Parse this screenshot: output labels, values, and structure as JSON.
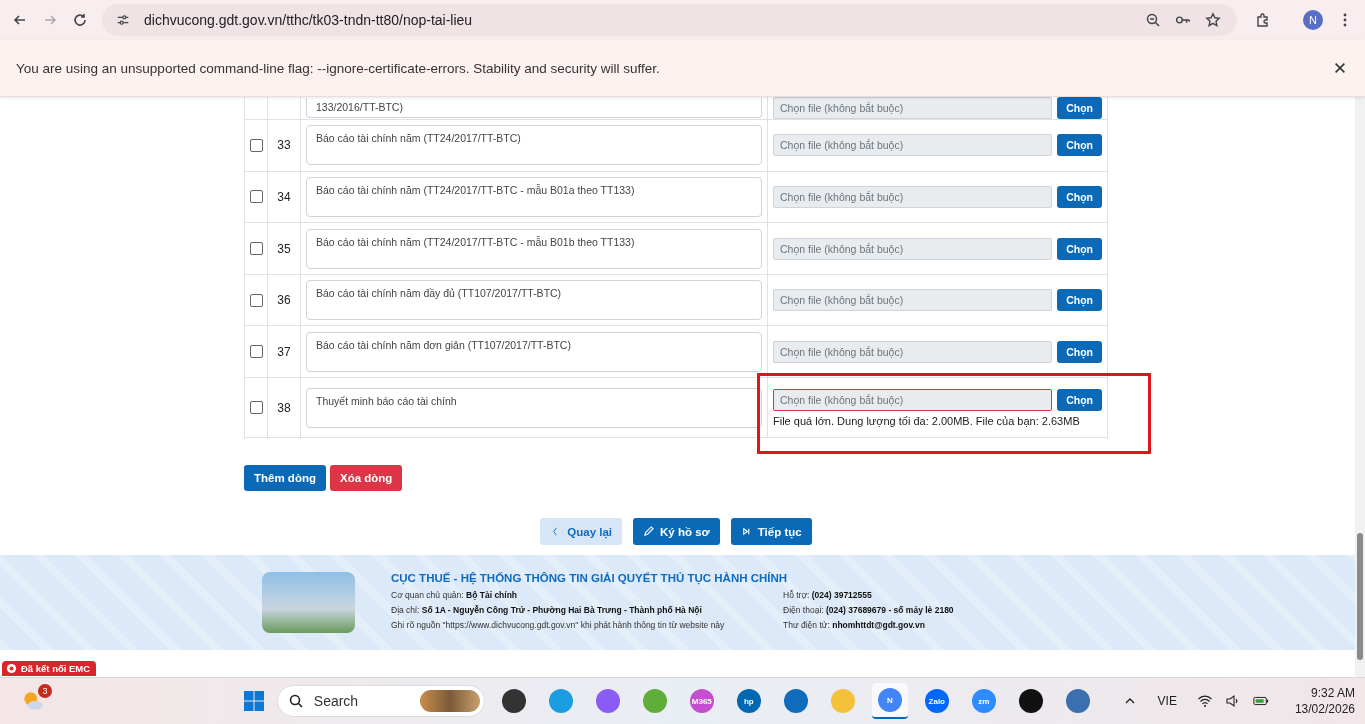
{
  "browser": {
    "url": "dichvucong.gdt.gov.vn/tthc/tk03-tndn-tt80/nop-tai-lieu",
    "profile_initial": "N"
  },
  "infobar": {
    "message": "You are using an unsupported command-line flag: --ignore-certificate-errors. Stability and security will suffer."
  },
  "table": {
    "rows": [
      {
        "description": "133/2016/TT-BTC)",
        "placeholder": "Chọn file (không bắt buộc)",
        "button": "Chọn",
        "cut": true,
        "error": false,
        "highlighted": false
      },
      {
        "number": "33",
        "checked": false,
        "description": "Báo cáo tài chính năm (TT24/2017/TT-BTC)",
        "placeholder": "Chọn file (không bắt buộc)",
        "button": "Chọn",
        "cut": false,
        "error": false,
        "highlighted": false
      },
      {
        "number": "34",
        "checked": false,
        "description": "Báo cáo tài chính năm (TT24/2017/TT-BTC - mẫu B01a theo TT133)",
        "placeholder": "Chọn file (không bắt buộc)",
        "button": "Chọn",
        "cut": false,
        "error": false,
        "highlighted": false
      },
      {
        "number": "35",
        "checked": false,
        "description": "Báo cáo tài chính năm (TT24/2017/TT-BTC - mẫu B01b theo TT133)",
        "placeholder": "Chọn file (không bắt buộc)",
        "button": "Chọn",
        "cut": false,
        "error": false,
        "highlighted": false
      },
      {
        "number": "36",
        "checked": false,
        "description": "Báo cáo tài chính năm đầy đủ (TT107/2017/TT-BTC)",
        "placeholder": "Chọn file (không bắt buộc)",
        "button": "Chọn",
        "cut": false,
        "error": false,
        "highlighted": false
      },
      {
        "number": "37",
        "checked": false,
        "description": "Báo cáo tài chính năm đơn giản (TT107/2017/TT-BTC)",
        "placeholder": "Chọn file (không bắt buộc)",
        "button": "Chọn",
        "cut": false,
        "error": false,
        "highlighted": false
      },
      {
        "number": "38",
        "checked": false,
        "description": "Thuyết minh báo cáo tài chính",
        "placeholder": "Chọn file (không bắt buộc)",
        "button": "Chọn",
        "cut": false,
        "error": true,
        "error_message": "File quá lớn. Dung lượng tối đa: 2.00MB. File của bạn: 2.63MB",
        "highlighted": true
      }
    ]
  },
  "row_buttons": [
    {
      "label": "Thêm dòng",
      "kind": "primary"
    },
    {
      "label": "Xóa dòng",
      "kind": "danger"
    }
  ],
  "nav_buttons": [
    {
      "label": "Quay lại",
      "kind": "back"
    },
    {
      "label": "Ký hồ sơ",
      "kind": "sign"
    },
    {
      "label": "Tiếp tục",
      "kind": "next"
    }
  ],
  "footer": {
    "title": "CỤC THUẾ - HỆ THỐNG THÔNG TIN GIẢI QUYẾT THỦ TỤC HÀNH CHÍNH",
    "left": [
      {
        "label": "Cơ quan chủ quản:",
        "value": "Bộ Tài chính"
      },
      {
        "label": "Địa chỉ:",
        "value": "Số 1A - Nguyễn Công Trứ - Phường Hai Bà Trưng - Thành phố Hà Nội"
      },
      {
        "label": "Ghi rõ nguồn \"https://www.dichvucong.gdt.gov.vn\" khi phát hành thông tin từ website này"
      }
    ],
    "right": [
      {
        "label": "Hỗ trợ:",
        "value": "(024) 39712555"
      },
      {
        "label": "Điện thoại:",
        "value": "(024) 37689679 - số máy lẻ 2180"
      },
      {
        "label": "Thư điện tử:",
        "value": "nhomhttdt@gdt.gov.vn"
      }
    ]
  },
  "status_badge": "Đã kết nối EMC",
  "taskbar": {
    "weather_badge": "3",
    "search_placeholder": "Search",
    "apps": [
      {
        "kind": "files"
      },
      {
        "kind": "edge"
      },
      {
        "kind": "copilot"
      },
      {
        "kind": "coccoc"
      },
      {
        "kind": "m365",
        "label": "M365"
      },
      {
        "kind": "hp",
        "label": "hp"
      },
      {
        "kind": "outlook"
      },
      {
        "kind": "folder"
      },
      {
        "kind": "chrome",
        "label": "N",
        "selected": true
      },
      {
        "kind": "zalo",
        "label": "Zalo"
      },
      {
        "kind": "zoom",
        "label": "zm"
      },
      {
        "kind": "dropbox"
      },
      {
        "kind": "calc"
      }
    ],
    "language": "VIE",
    "time": "9:32 AM",
    "date": "13/02/2026"
  }
}
